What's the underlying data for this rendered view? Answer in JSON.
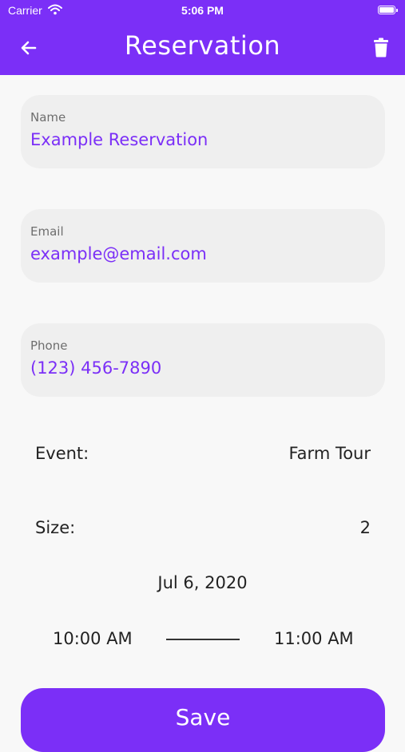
{
  "status": {
    "carrier": "Carrier",
    "time": "5:06 PM"
  },
  "appbar": {
    "title": "Reservation"
  },
  "fields": {
    "name": {
      "label": "Name",
      "value": "Example Reservation"
    },
    "email": {
      "label": "Email",
      "value": "example@email.com"
    },
    "phone": {
      "label": "Phone",
      "value": "(123) 456-7890"
    }
  },
  "event": {
    "label": "Event:",
    "value": "Farm Tour"
  },
  "size": {
    "label": "Size:",
    "value": "2"
  },
  "schedule": {
    "date": "Jul 6, 2020",
    "start": "10:00 AM",
    "end": "11:00 AM"
  },
  "actions": {
    "save": "Save"
  },
  "colors": {
    "accent": "#7b2ff7",
    "field_bg": "#efefef"
  },
  "icons": {
    "back": "arrow-left-icon",
    "delete": "trash-icon",
    "wifi": "wifi-icon",
    "battery": "battery-icon"
  }
}
